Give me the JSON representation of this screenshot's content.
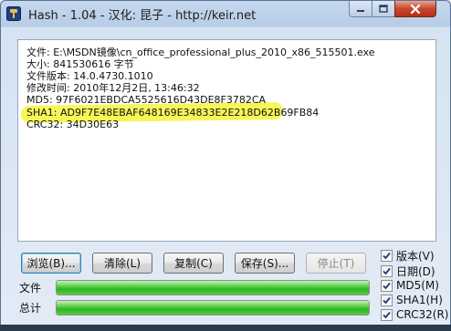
{
  "window": {
    "title": "Hash - 1.04 - 汉化: 昆子 - http://keir.net"
  },
  "output_lines": [
    "文件: E:\\MSDN镜像\\cn_office_professional_plus_2010_x86_515501.exe",
    "大小: 841530616 字节",
    "文件版本: 14.0.4730.1010",
    "修改时间: 2010年12月2日, 13:46:32",
    "MD5: 97F6021EBDCA5525616D43DE8F3782CA",
    "SHA1: AD9F7E48EBAF648169E34833E2E218D62B69FB84",
    "CRC32: 34D30E63"
  ],
  "buttons": {
    "browse": "浏览(B)...",
    "clear": "清除(L)",
    "copy": "复制(C)",
    "save": "保存(S)...",
    "stop": "停止(T)"
  },
  "progress": {
    "file_label": "文件",
    "file_value": 1.0,
    "total_label": "总计",
    "total_value": 1.0
  },
  "options": [
    {
      "label": "版本(V)",
      "checked": true
    },
    {
      "label": "日期(D)",
      "checked": true
    },
    {
      "label": "MD5(M)",
      "checked": true
    },
    {
      "label": "SHA1(H)",
      "checked": true
    },
    {
      "label": "CRC32(R)",
      "checked": true
    }
  ],
  "colors": {
    "highlight": "#f4f43c",
    "progress_green": "#2fb51f"
  }
}
